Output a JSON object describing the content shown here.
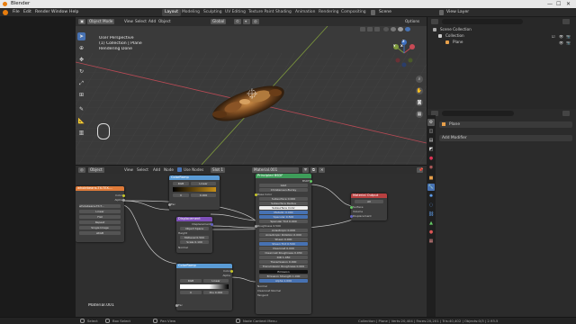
{
  "window": {
    "title": "Blender",
    "controls": {
      "minimize": "—",
      "maximize": "☐",
      "close": "✕"
    }
  },
  "menubar": {
    "menus": [
      "File",
      "Edit",
      "Render",
      "Window",
      "Help"
    ],
    "workspaces": [
      "Layout",
      "Modeling",
      "Sculpting",
      "UV Editing",
      "Texture Paint",
      "Shading",
      "Animation",
      "Rendering",
      "Compositing"
    ],
    "active_workspace": "Layout",
    "scene": "Scene",
    "view_layer": "View Layer"
  },
  "viewport": {
    "mode": "Object Mode",
    "menus": [
      "View",
      "Select",
      "Add",
      "Object"
    ],
    "orientation": "Global",
    "options": "Options",
    "overlay_text": [
      "User Perspective",
      "(1) Collection | Plane",
      "Rendering Done"
    ],
    "gizmo": {
      "x": "X",
      "y": "Y",
      "z": "Z"
    }
  },
  "outliner": {
    "items": [
      {
        "label": "Scene Collection",
        "indent": 0
      },
      {
        "label": "Collection",
        "indent": 1
      },
      {
        "label": "Plane",
        "indent": 2
      }
    ]
  },
  "properties": {
    "object_name": "Plane",
    "add_modifier": "Add Modifier"
  },
  "node_editor": {
    "editor_type": "Object",
    "menus": [
      "View",
      "Select",
      "Add",
      "Node"
    ],
    "use_nodes_label": "Use Nodes",
    "slot": "Slot 1",
    "material": "Material.001",
    "material_corner_label": "Material.001",
    "image_node": {
      "title": "wholebeans-TX-TEX-...",
      "rows": [
        "Color",
        "Alpha",
        "wholebeans-TX-T...",
        "Linear",
        "Flat",
        "Repeat",
        "Single Image",
        "sRGB"
      ]
    },
    "colorramp_node": {
      "title": "ColorRamp",
      "rows": [
        "RGB",
        "Linear",
        "0",
        "0.000",
        "Fac",
        "Color",
        "Alpha"
      ]
    },
    "displacement_node": {
      "title": "Displacement",
      "rows": [
        "Displacement",
        "Object Space",
        "Height",
        "Midlevel 0.500",
        "Scale 0.100",
        "Normal"
      ]
    },
    "colorramp2_node": {
      "title": "ColorRamp",
      "rows": [
        "Color",
        "Alpha",
        "RGB",
        "Linear",
        "0",
        "Pos 0.000",
        "Fac"
      ]
    },
    "bsdf_node": {
      "title": "Principled BSDF",
      "rows": [
        "BSDF",
        "GGX",
        "Christensen-Burley",
        "Base Color",
        "Subsurface 0.000",
        "Subsurface Radius",
        "Subsurface Color",
        "Metallic 0.000",
        "Specular 0.500",
        "Specular Tint 0.000",
        "Roughness 0.500",
        "Anisotropic 0.000",
        "Anisotropic Rotation 0.000",
        "Sheen 0.000",
        "Sheen Tint 0.500",
        "Clearcoat 0.000",
        "Clearcoat Roughness 0.030",
        "IOR 1.450",
        "Transmission 0.000",
        "Transmission Roughness 0.000",
        "Emission",
        "Emission Strength 1.000",
        "Alpha 1.000",
        "Normal",
        "Clearcoat Normal",
        "Tangent"
      ]
    },
    "output_node": {
      "title": "Material Output",
      "rows": [
        "All",
        "Surface",
        "Volume",
        "Displacement"
      ]
    }
  },
  "statusbar": {
    "left": [
      "Select",
      "Box Select",
      "Pan View"
    ],
    "middle": "Node Context Menu",
    "stats": "Collection | Plane | Verts:20,404 | Faces:20,201 | Tris:40,402 | Objects:0/3 | 2.93.5"
  },
  "colors": {
    "accent": "#4772b3",
    "node_image": "#e07b39",
    "node_converter": "#5a9bd5",
    "node_vector": "#7d4fb7",
    "node_shader": "#3e9d5a",
    "node_output": "#b84040"
  }
}
